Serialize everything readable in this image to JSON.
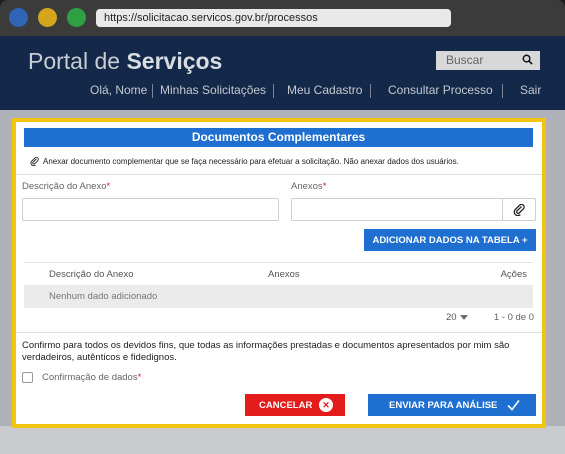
{
  "browser": {
    "url": "https://solicitacao.servicos.gov.br/processos"
  },
  "portal": {
    "brand_regular": "Portal de",
    "brand_bold": "Serviços",
    "search_placeholder": "Buscar",
    "nav": [
      "Olá, Nome",
      "Minhas Solicitações",
      "Meu Cadastro",
      "Consultar Processo",
      "Sair"
    ]
  },
  "modal": {
    "title": "Documentos Complementares",
    "hint": "Anexar documento complementar que se faça necessário para efetuar a solicitação. Não anexar dados dos usuários.",
    "desc_label": "Descrição do Anexo",
    "attach_label": "Anexos",
    "required_mark": "*",
    "add_button": "ADICIONAR DADOS NA TABELA +",
    "table": {
      "columns": [
        "Descrição do Anexo",
        "Anexos",
        "Ações"
      ],
      "empty_text": "Nenhum dado adicionado"
    },
    "pager": {
      "page_size": "20",
      "range": "1 - 0 de 0"
    },
    "confirm_text": "Confirmo para todos os devidos fins, que todas as informações prestadas e documentos apresentados por mim são verdadeiros, autênticos e fidedignos.",
    "confirm_label": "Confirmação de dados",
    "cancel_button": "CANCELAR",
    "send_button": "ENVIAR PARA ANÁLISE"
  },
  "colors": {
    "header_bg": "#14294a",
    "primary": "#1e6fd0",
    "danger": "#e31b1b",
    "highlight_border": "#f1c40f"
  }
}
